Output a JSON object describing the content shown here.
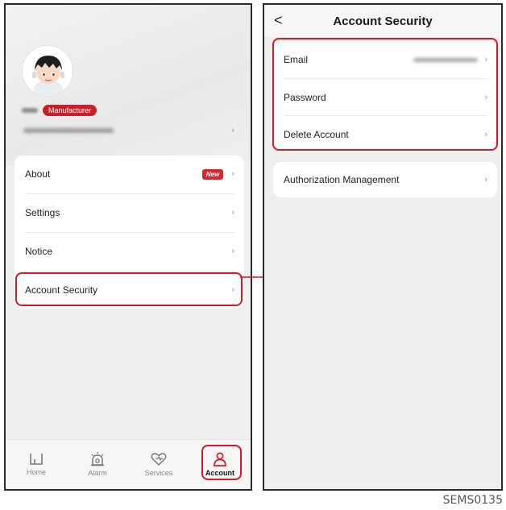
{
  "left_screen": {
    "user": {
      "role_badge": "Manufacturer"
    },
    "menu": {
      "items": [
        {
          "label": "About",
          "badge": "New"
        },
        {
          "label": "Settings"
        },
        {
          "label": "Notice"
        },
        {
          "label": "Account Security"
        }
      ]
    },
    "tabbar": {
      "tabs": [
        {
          "label": "Home",
          "icon": "home-icon"
        },
        {
          "label": "Alarm",
          "icon": "alarm-icon"
        },
        {
          "label": "Services",
          "icon": "services-heart-icon"
        },
        {
          "label": "Account",
          "icon": "account-icon",
          "active": true
        }
      ]
    }
  },
  "right_screen": {
    "nav": {
      "title": "Account Security",
      "back": "<"
    },
    "security": {
      "items": [
        {
          "label": "Email"
        },
        {
          "label": "Password"
        },
        {
          "label": "Delete Account"
        }
      ]
    },
    "authorization": {
      "label": "Authorization Management"
    }
  },
  "caption": "SEMS0135",
  "colors": {
    "accent_red": "#d71920",
    "background": "#efefef",
    "card": "#ffffff"
  }
}
